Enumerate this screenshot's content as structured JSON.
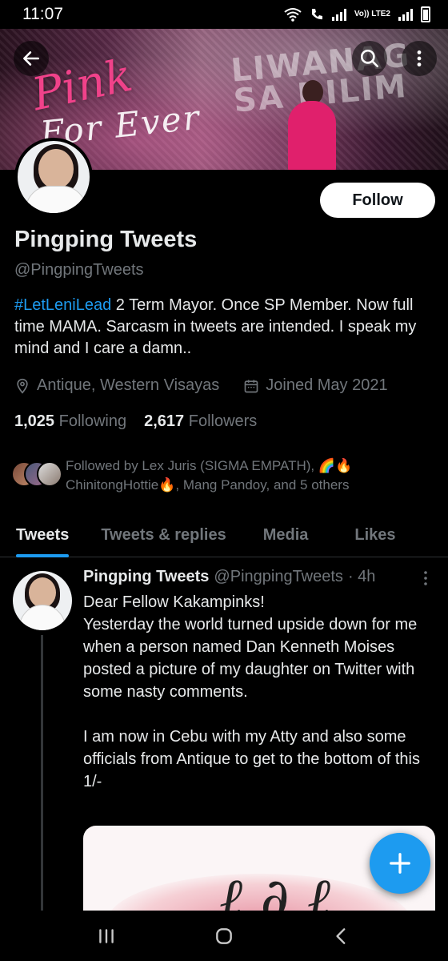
{
  "status_bar": {
    "time": "11:07",
    "volte": "Vo)) LTE2"
  },
  "banner": {
    "script_line1": "Pink",
    "script_line2": "For Ever",
    "overlay_text": "LIWANAG SA DILIM"
  },
  "profile": {
    "name": "Pingping Tweets",
    "handle": "@PingpingTweets",
    "follow_label": "Follow",
    "bio_hashtag": "#LetLeniLead",
    "bio_text": " 2 Term Mayor. Once SP Member. Now full time MAMA. Sarcasm in tweets are intended. I speak my mind and I care a damn..",
    "location": "Antique, Western Visayas",
    "joined": "Joined May 2021",
    "following_count": "1,025",
    "following_label": "Following",
    "followers_count": "2,617",
    "followers_label": "Followers",
    "followed_by": "Followed by Lex Juris (SIGMA EMPATH), 🌈🔥 ChinitongHottie🔥, Mang Pandoy, and 5 others"
  },
  "tabs": [
    {
      "label": "Tweets",
      "active": true
    },
    {
      "label": "Tweets & replies",
      "active": false
    },
    {
      "label": "Media",
      "active": false
    },
    {
      "label": "Likes",
      "active": false
    }
  ],
  "tweet": {
    "name": "Pingping Tweets",
    "handle": "@PingpingTweets",
    "time": "· 4h",
    "body": "Dear Fellow Kakampinks!\nYesterday the world turned upside down for me when a person named Dan Kenneth Moises posted a picture of my daughter on Twitter with some nasty comments.\n\nI am now in Cebu with my Atty and also some officials from Antique to get to the bottom of this\n1/-"
  },
  "colors": {
    "accent": "#1d9bf0",
    "background": "#000000",
    "text_primary": "#e7e9ea",
    "text_secondary": "#71767b"
  },
  "icons": [
    "back-arrow-icon",
    "search-icon",
    "more-vertical-icon",
    "location-pin-icon",
    "calendar-icon",
    "compose-plus-icon",
    "recent-apps-icon",
    "home-icon",
    "nav-back-icon"
  ]
}
